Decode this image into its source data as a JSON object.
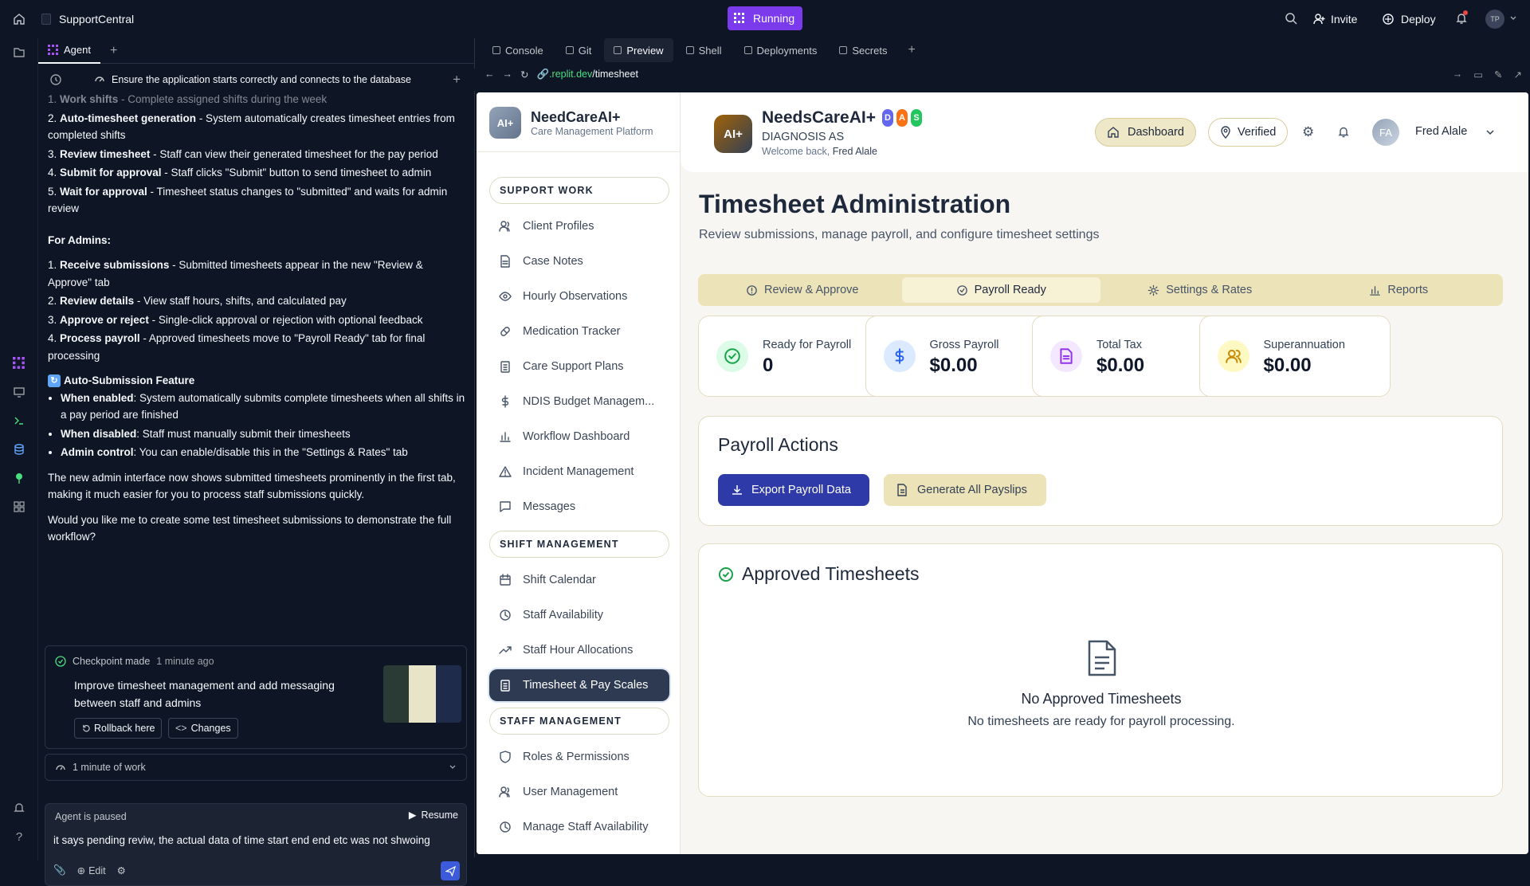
{
  "topbar": {
    "project_name": "SupportCentral",
    "run_status": "Running",
    "invite_label": "Invite",
    "deploy_label": "Deploy",
    "avatar_initials": "TP"
  },
  "agent_panel": {
    "tab_label": "Agent",
    "task_title": "Ensure the application starts correctly and connects to the database",
    "staff_steps": [
      {
        "n": "1.",
        "bold": "Work shifts",
        "text": " - Complete assigned shifts during the week"
      },
      {
        "n": "2.",
        "bold": "Auto-timesheet generation",
        "text": " - System automatically creates timesheet entries from completed shifts"
      },
      {
        "n": "3.",
        "bold": "Review timesheet",
        "text": " - Staff can view their generated timesheet for the pay period"
      },
      {
        "n": "4.",
        "bold": "Submit for approval",
        "text": " - Staff clicks \"Submit\" button to send timesheet to admin"
      },
      {
        "n": "5.",
        "bold": "Wait for approval",
        "text": " - Timesheet status changes to \"submitted\" and waits for admin review"
      }
    ],
    "admins_heading": "For Admins:",
    "admin_steps": [
      {
        "n": "1.",
        "bold": "Receive submissions",
        "text": " - Submitted timesheets appear in the new \"Review & Approve\" tab"
      },
      {
        "n": "2.",
        "bold": "Review details",
        "text": " - View staff hours, shifts, and calculated pay"
      },
      {
        "n": "3.",
        "bold": "Approve or reject",
        "text": " - Single-click approval or rejection with optional feedback"
      },
      {
        "n": "4.",
        "bold": "Process payroll",
        "text": " - Approved timesheets move to \"Payroll Ready\" tab for final processing"
      }
    ],
    "auto_heading": "Auto-Submission Feature",
    "auto_items": [
      {
        "bold": "When enabled",
        "text": ": System automatically submits complete timesheets when all shifts in a pay period are finished"
      },
      {
        "bold": "When disabled",
        "text": ": Staff must manually submit their timesheets"
      },
      {
        "bold": "Admin control",
        "text": ": You can enable/disable this in the \"Settings & Rates\" tab"
      }
    ],
    "para1": "The new admin interface now shows submitted timesheets prominently in the first tab, making it much easier for you to process staff submissions quickly.",
    "para2": "Would you like me to create some test timesheet submissions to demonstrate the full workflow?",
    "checkpoint_label": "Checkpoint made",
    "checkpoint_time": "1 minute ago",
    "checkpoint_text": "Improve timesheet management and add messaging between staff and admins",
    "rollback_label": "Rollback here",
    "changes_label": "Changes",
    "work_time": "1 minute of work",
    "paused_label": "Agent is paused",
    "resume_label": "Resume",
    "input_value": "it says pending reviw, the actual data of time start end end etc was not shwoing",
    "edit_label": "Edit"
  },
  "devtabs": [
    {
      "label": "Console",
      "icon": "terminal-icon"
    },
    {
      "label": "Git",
      "icon": "git-icon"
    },
    {
      "label": "Preview",
      "icon": "preview-icon"
    },
    {
      "label": "Shell",
      "icon": "shell-icon"
    },
    {
      "label": "Deployments",
      "icon": "deploy-icon"
    },
    {
      "label": "Secrets",
      "icon": "lock-icon"
    }
  ],
  "url": {
    "domain": ".replit.dev",
    "path": "/timesheet"
  },
  "app": {
    "brand_logo": "AI+",
    "brand_name": "NeedCareAI+",
    "brand_sub": "Care Management Platform",
    "sections": [
      {
        "title": "SUPPORT WORK",
        "items": [
          {
            "label": "Client Profiles",
            "icon": "users-icon"
          },
          {
            "label": "Case Notes",
            "icon": "file-icon"
          },
          {
            "label": "Hourly Observations",
            "icon": "eye-icon"
          },
          {
            "label": "Medication Tracker",
            "icon": "pill-icon"
          },
          {
            "label": "Care Support Plans",
            "icon": "clipboard-icon"
          },
          {
            "label": "NDIS Budget Managem...",
            "icon": "dollar-icon"
          },
          {
            "label": "Workflow Dashboard",
            "icon": "bar-chart-icon"
          },
          {
            "label": "Incident Management",
            "icon": "alert-icon"
          },
          {
            "label": "Messages",
            "icon": "message-icon"
          }
        ]
      },
      {
        "title": "SHIFT MANAGEMENT",
        "items": [
          {
            "label": "Shift Calendar",
            "icon": "calendar-icon"
          },
          {
            "label": "Staff Availability",
            "icon": "clock-icon"
          },
          {
            "label": "Staff Hour Allocations",
            "icon": "trend-icon"
          },
          {
            "label": "Timesheet & Pay Scales",
            "icon": "timesheet-icon",
            "active": true
          }
        ]
      },
      {
        "title": "STAFF MANAGEMENT",
        "items": [
          {
            "label": "Roles & Permissions",
            "icon": "shield-icon"
          },
          {
            "label": "User Management",
            "icon": "users-icon"
          },
          {
            "label": "Manage Staff Availability",
            "icon": "clock-icon"
          }
        ]
      }
    ],
    "header": {
      "org_logo": "AI+",
      "org_name": "NeedsCareAI+",
      "badges": [
        "D",
        "A",
        "S"
      ],
      "org_sub": "DIAGNOSIS AS",
      "welcome": "Welcome back,",
      "user_name": "Fred Alale",
      "dashboard_label": "Dashboard",
      "verified_label": "Verified",
      "user_initials": "FA"
    },
    "page_title": "Timesheet Administration",
    "page_subtitle": "Review submissions, manage payroll, and configure timesheet settings",
    "tabs": [
      {
        "label": "Review & Approve",
        "icon": "alert-circle-icon"
      },
      {
        "label": "Payroll Ready",
        "icon": "check-circle-icon",
        "active": true
      },
      {
        "label": "Settings & Rates",
        "icon": "gear-icon"
      },
      {
        "label": "Reports",
        "icon": "bar-chart-icon"
      }
    ],
    "stats": [
      {
        "label": "Ready for Payroll",
        "value": "0",
        "color": "#16a34a",
        "bg": "#dcfce7",
        "icon": "check-circle-icon"
      },
      {
        "label": "Gross Payroll",
        "value": "$0.00",
        "color": "#2563eb",
        "bg": "#dbeafe",
        "icon": "dollar-icon"
      },
      {
        "label": "Total Tax",
        "value": "$0.00",
        "color": "#9333ea",
        "bg": "#f3e8ff",
        "icon": "document-icon"
      },
      {
        "label": "Superannuation",
        "value": "$0.00",
        "color": "#ca8a04",
        "bg": "#fef9c3",
        "icon": "users-icon"
      }
    ],
    "payroll_actions_title": "Payroll Actions",
    "export_label": "Export Payroll Data",
    "payslips_label": "Generate All Payslips",
    "approved_title": "Approved Timesheets",
    "empty_title": "No Approved Timesheets",
    "empty_sub": "No timesheets are ready for payroll processing."
  }
}
